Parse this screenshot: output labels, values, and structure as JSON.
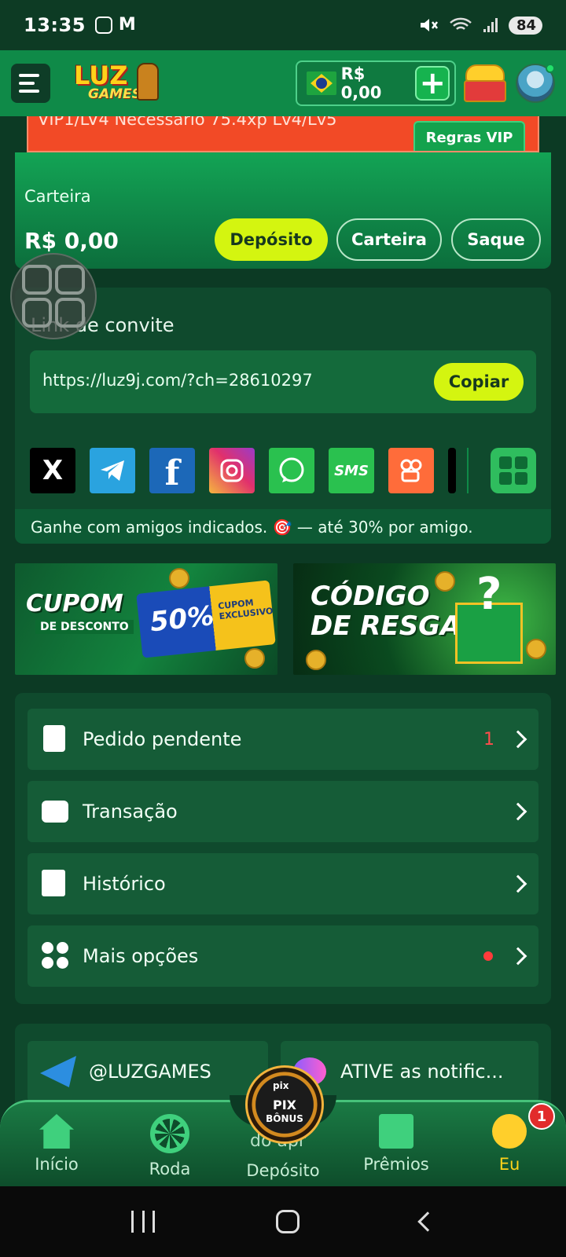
{
  "status_bar": {
    "time": "13:35",
    "left_icons": [
      "instagram-icon",
      "gmail-icon"
    ],
    "m_glyph": "M",
    "right_icons": [
      "mute-icon",
      "wifi-icon",
      "signal-icon"
    ],
    "battery": "84"
  },
  "header": {
    "logo_line1": "LUZ",
    "logo_line2": "GAMES",
    "balance": "R$ 0,00",
    "plus_label": "+"
  },
  "vip": {
    "text": "VIP1/LV4  Necessário 75.4xp Lv4/Lv5",
    "button": "Regras VIP"
  },
  "wallet": {
    "label": "Carteira",
    "amount": "R$ 0,00",
    "deposit_button": "Depósito",
    "wallet_button": "Carteira",
    "withdraw_button": "Saque"
  },
  "invite": {
    "title": "Link de convite",
    "link": "https://luz9j.com/?ch=28610297",
    "copy_button": "Copiar",
    "socials": [
      "x",
      "telegram",
      "facebook",
      "instagram",
      "whatsapp",
      "sms",
      "kwai",
      "more-apps"
    ],
    "x_glyph": "X",
    "fb_glyph": "f",
    "sms_label": "SMS",
    "footer": "Ganhe com amigos indicados. 🎯 — até 30% por amigo."
  },
  "banners": {
    "cupom": {
      "line1": "CUPOM",
      "line2": "DE DESCONTO",
      "discount": "50%",
      "tag": "CUPOM EXCLUSIVO"
    },
    "codigo": {
      "line1": "CÓDIGO",
      "line2": "DE RESGATE"
    }
  },
  "menu": {
    "items": [
      {
        "label": "Pedido pendente",
        "count": "1"
      },
      {
        "label": "Transação"
      },
      {
        "label": "Histórico"
      },
      {
        "label": "Mais opções"
      }
    ]
  },
  "social_card": {
    "telegram": "@LUZGAMES",
    "notifications": "ATIVE as notific..."
  },
  "bottom_nav": {
    "items": [
      {
        "label": "Início"
      },
      {
        "label": "Roda"
      },
      {
        "label": "Depósito"
      },
      {
        "label": "Prêmios"
      },
      {
        "label": "Eu"
      }
    ],
    "badge": "1",
    "behind_text": "do apr",
    "fab": {
      "line1": "pix",
      "line2": "PIX",
      "line3": "BÔNUS"
    }
  },
  "colors": {
    "background": "#0c3a24",
    "header": "#0f8a48",
    "accent": "#d4f510",
    "vip": "#f24a26",
    "active_nav": "#ffd21a"
  }
}
